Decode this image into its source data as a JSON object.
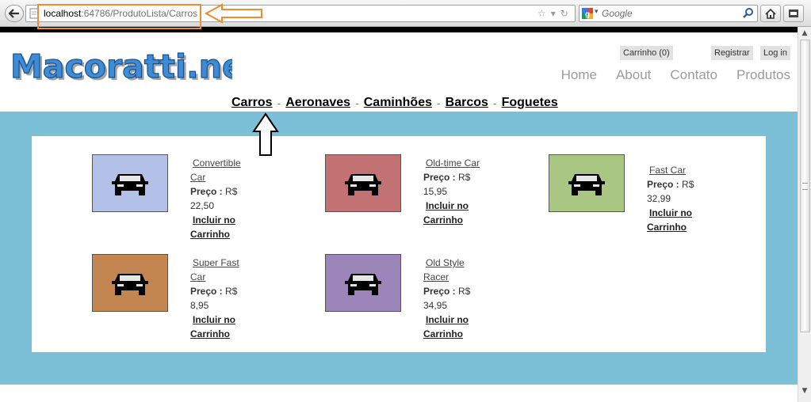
{
  "browser": {
    "url_host": "localhost",
    "url_path": ":64786/ProdutoLista/Carros",
    "search_placeholder": "Google"
  },
  "site": {
    "logo_text": "Macoratti.net",
    "cart_label": "Carrinho (0)",
    "register_label": "Registrar",
    "login_label": "Log in",
    "nav": [
      "Home",
      "About",
      "Contato",
      "Produtos"
    ],
    "categories": [
      "Carros",
      "Aeronaves",
      "Caminhões",
      "Barcos",
      "Foguetes"
    ],
    "category_separator": "-"
  },
  "products": [
    {
      "name": "Convertible Car",
      "price_label": "Preço :",
      "price": "R$ 22,50",
      "buy_label": "Incluir no Carrinho",
      "color": "#b3c0e8"
    },
    {
      "name": "Old-time Car",
      "price_label": "Preço :",
      "price": "R$ 15,95",
      "buy_label": "Incluir no Carrinho",
      "color": "#c37273"
    },
    {
      "name": "Fast Car",
      "price_label": "Preço :",
      "price": "R$ 32,99",
      "buy_label": "Incluir no Carrinho",
      "color": "#a9c683"
    },
    {
      "name": "Super Fast Car",
      "price_label": "Preço :",
      "price": "R$ 8,95",
      "buy_label": "Incluir no Carrinho",
      "color": "#c48651"
    },
    {
      "name": "Old Style Racer",
      "price_label": "Preço :",
      "price": "R$ 34,95",
      "buy_label": "Incluir no Carrinho",
      "color": "#9c86b9"
    }
  ],
  "colors": {
    "band": "#7cc0d8",
    "highlight": "#f28a2e",
    "nav": "#9b9b9b"
  }
}
